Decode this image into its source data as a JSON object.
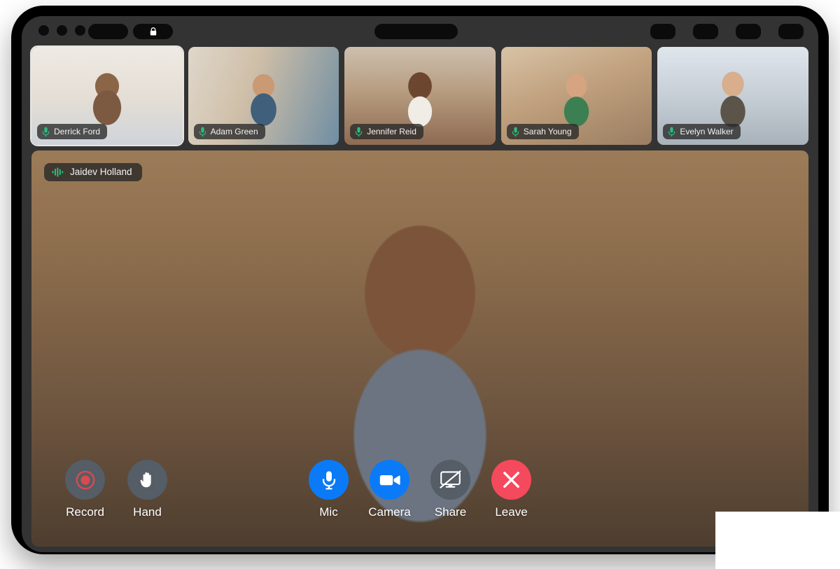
{
  "app": {
    "window_title": "",
    "titlebar": {
      "traffic_lights": [
        "close",
        "minimize",
        "maximize"
      ],
      "left_pill_label": "",
      "lock_icon": "lock-icon",
      "center_pill_label": "",
      "right_buttons": [
        "button-1",
        "button-2",
        "button-3",
        "button-4"
      ]
    }
  },
  "participants": [
    {
      "name": "Derrick Ford",
      "mic_icon": "microphone-icon",
      "mic_active": true,
      "focused": true
    },
    {
      "name": "Adam Green",
      "mic_icon": "microphone-icon",
      "mic_active": true,
      "focused": false
    },
    {
      "name": "Jennifer Reid",
      "mic_icon": "microphone-icon",
      "mic_active": true,
      "focused": false
    },
    {
      "name": "Sarah Young",
      "mic_icon": "microphone-icon",
      "mic_active": true,
      "focused": false
    },
    {
      "name": "Evelyn Walker",
      "mic_icon": "microphone-icon",
      "mic_active": true,
      "focused": false
    }
  ],
  "active_speaker": {
    "name": "Jaidev Holland",
    "status_icon": "audio-waveform-icon",
    "speaking": true
  },
  "controls": {
    "left": [
      {
        "id": "record",
        "label": "Record",
        "icon": "record-icon",
        "circle_color": "#555d66",
        "icon_color": "#d94a4f",
        "state": "idle"
      },
      {
        "id": "hand",
        "label": "Hand",
        "icon": "raised-hand-icon",
        "circle_color": "#555d66",
        "icon_color": "#ffffff",
        "state": "idle"
      }
    ],
    "center": [
      {
        "id": "mic",
        "label": "Mic",
        "icon": "microphone-icon",
        "circle_color": "#0b7af7",
        "icon_color": "#ffffff",
        "state": "on"
      },
      {
        "id": "camera",
        "label": "Camera",
        "icon": "video-camera-icon",
        "circle_color": "#0b7af7",
        "icon_color": "#ffffff",
        "state": "on"
      },
      {
        "id": "share",
        "label": "Share",
        "icon": "screen-share-off-icon",
        "circle_color": "#555d66",
        "icon_color": "#ffffff",
        "state": "off"
      },
      {
        "id": "leave",
        "label": "Leave",
        "icon": "close-x-icon",
        "circle_color": "#f5495d",
        "icon_color": "#ffffff",
        "state": "action"
      }
    ]
  },
  "colors": {
    "accent_blue": "#0b7af7",
    "leave_red": "#f5495d",
    "record_red": "#d94a4f",
    "control_gray": "#555d66",
    "mic_green": "#2bbd7e",
    "bezel": "#333333",
    "frame": "#000000",
    "badge_bg": "rgba(40,40,40,0.78)",
    "page_bg": "#ffffff"
  }
}
